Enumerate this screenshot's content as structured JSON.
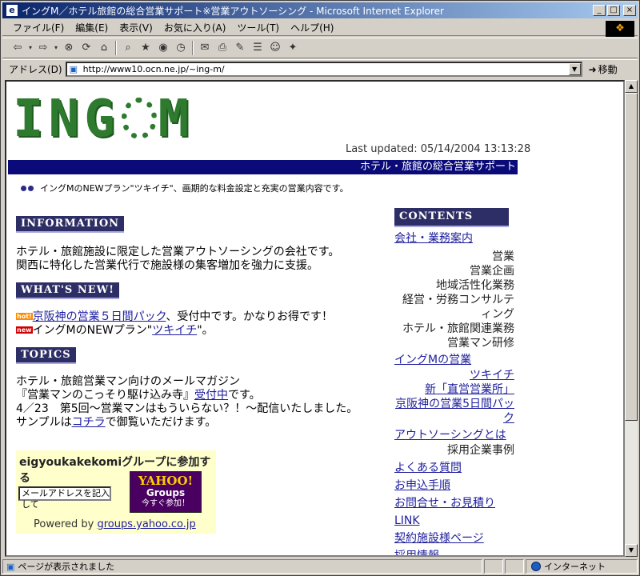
{
  "window": {
    "title": "イングM／ホテル旅館の総合営業サポート※営業アウトソーシング - Microsoft Internet Explorer"
  },
  "menu": [
    "ファイル(F)",
    "編集(E)",
    "表示(V)",
    "お気に入り(A)",
    "ツール(T)",
    "ヘルプ(H)"
  ],
  "address": {
    "label": "アドレス(D)",
    "url": "http://www10.ocn.ne.jp/~ing-m/",
    "go": "移動"
  },
  "status": {
    "text": "ページが表示されました",
    "zone": "インターネット"
  },
  "page": {
    "logo": "ING M",
    "last_updated": "Last updated: 05/14/2004 13:13:28",
    "banner": "ホテル・旅館の総合営業サポート",
    "note": "イングMのNEWプラン\"ツキイチ\"、画期的な料金設定と充実の営業内容です。",
    "information": {
      "heading": "INFORMATION",
      "line1": "ホテル・旅館施設に限定した営業アウトソーシングの会社です。",
      "line2": "関西に特化した営業代行で施設様の集客増加を強力に支援。"
    },
    "whats_new": {
      "heading": "WHAT'S NEW!",
      "hot_badge": "hot!",
      "item1_link": "京阪神の営業５日間パック",
      "item1_text": "、受付中です。かなりお得です！",
      "new_badge": "new",
      "item2_text": "イングMのNEWプラン\"",
      "item2_link": "ツキイチ",
      "item2_end": "\"。"
    },
    "topics": {
      "heading": "TOPICS",
      "line1": "ホテル・旅館営業マン向けのメールマガジン",
      "line2a": "『営業マンのこっそり駆け込み寺』",
      "line2_link": "受付中",
      "line2b": "です。",
      "line3": "4／23　第5回〜営業マンはもういらない？！〜配信いたしました。",
      "line4a": "サンプルは",
      "line4_link": "コチラ",
      "line4b": "で御覧いただけます。"
    },
    "yahoo_group": {
      "title": "eigyoukakekomiグループに参加する",
      "email_placeholder": "メールアドレスを記入して",
      "btn_line1": "YAHOO!",
      "btn_line2": "Groups",
      "btn_line3": "今すぐ参加！",
      "powered": "Powered by",
      "powered_link": "groups.yahoo.co.jp"
    },
    "contents": {
      "heading": "CONTENTS",
      "company_link": "会社・業務案内",
      "company_items": [
        "営業",
        "営業企画",
        "地域活性化業務",
        "経営・労務コンサルティング",
        "ホテル・旅館関連業務",
        "営業マン研修"
      ],
      "ing_sales_link": "イングMの営業",
      "ing_sales_items": [
        "ツキイチ",
        "新「直営営業所」",
        "京阪神の営業5日間パック"
      ],
      "outsourcing_link": "アウトソーシングとは",
      "outsourcing_item": "採用企業事例",
      "links": [
        "よくある質問",
        "お申込手順",
        "お問合せ・お見積り",
        "LINK",
        "契約施設様ページ",
        "採用情報"
      ]
    }
  }
}
